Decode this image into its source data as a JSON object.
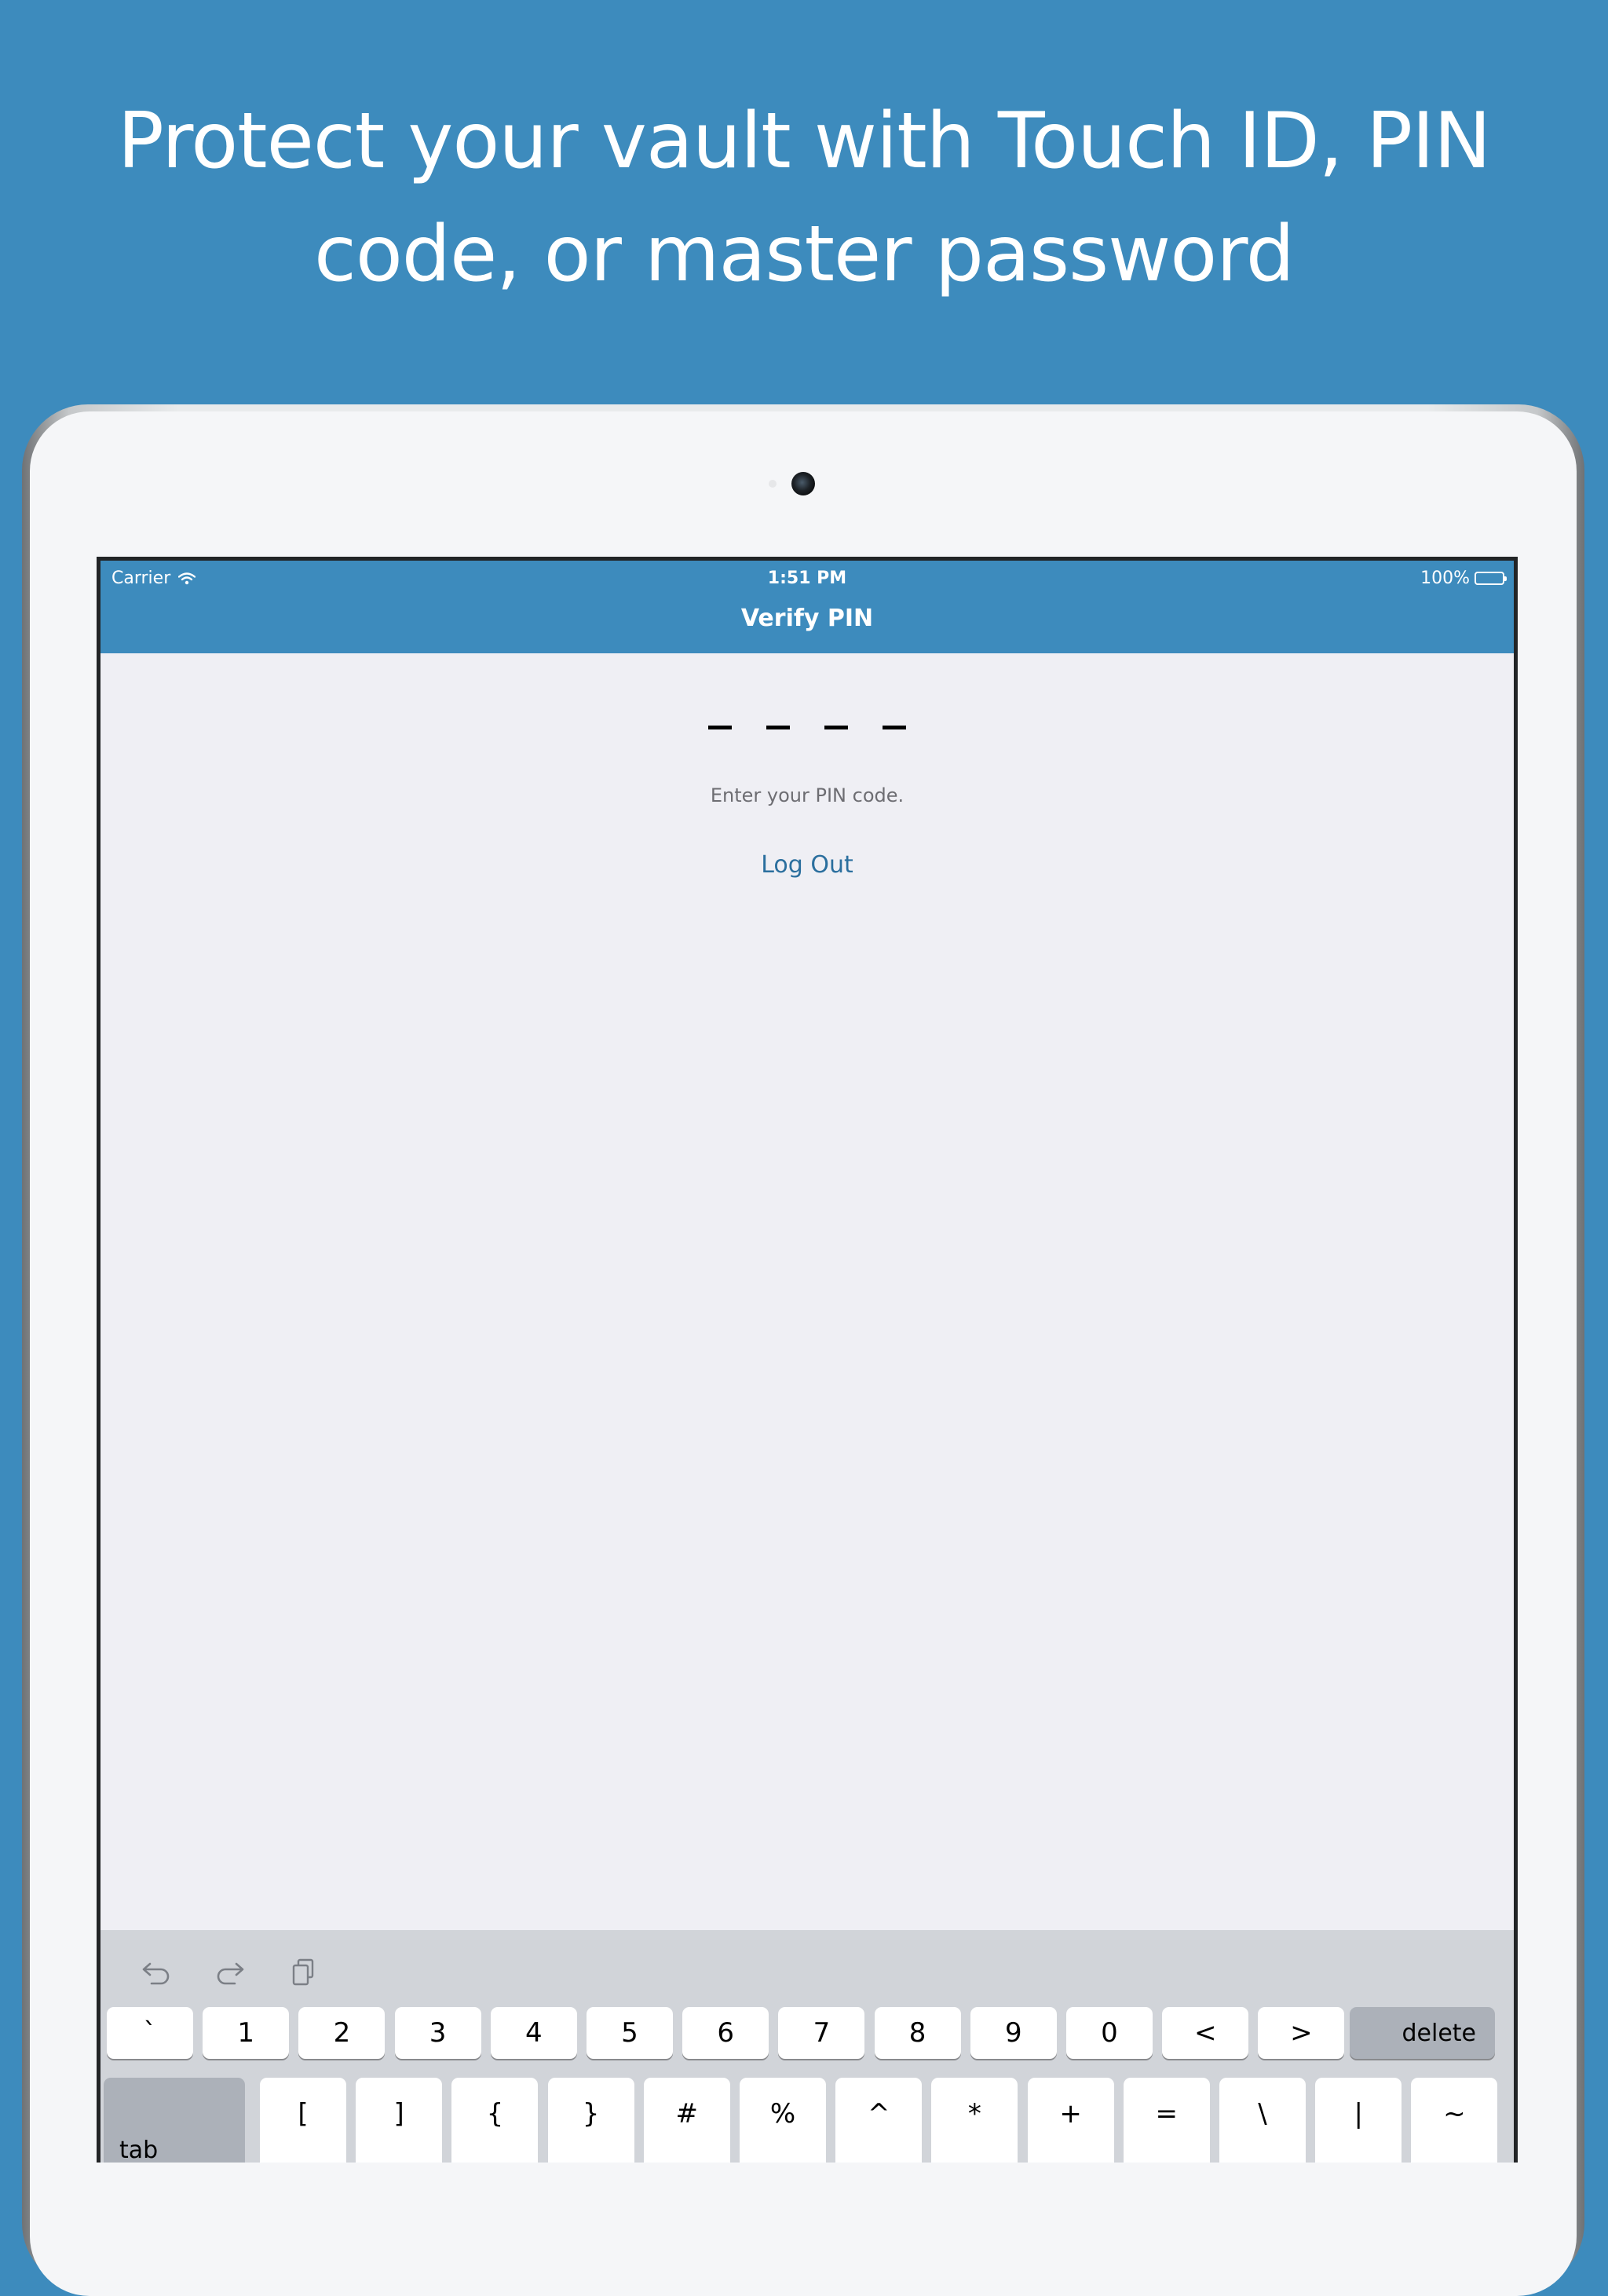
{
  "headline": {
    "line1": "Protect your vault with Touch ID, PIN",
    "line2": "code, or master password"
  },
  "status_bar": {
    "carrier": "Carrier",
    "time": "1:51 PM",
    "battery": "100%"
  },
  "nav": {
    "title": "Verify PIN"
  },
  "pin": {
    "digits_total": 4,
    "hint": "Enter your PIN code.",
    "logout_label": "Log Out"
  },
  "keyboard": {
    "tools": [
      "undo-icon",
      "redo-icon",
      "paste-icon"
    ],
    "row1": [
      "`",
      "1",
      "2",
      "3",
      "4",
      "5",
      "6",
      "7",
      "8",
      "9",
      "0",
      "<",
      ">"
    ],
    "delete_label": "delete",
    "tab_label": "tab",
    "row2": [
      "[",
      "]",
      "{",
      "}",
      "#",
      "%",
      "^",
      "*",
      "+",
      "=",
      "\\",
      "|",
      "~"
    ]
  },
  "colors": {
    "brand": "#3d8bbd",
    "link": "#2b6f9e",
    "screen_bg": "#efeff4",
    "keyboard_bg": "#d1d4d9"
  }
}
